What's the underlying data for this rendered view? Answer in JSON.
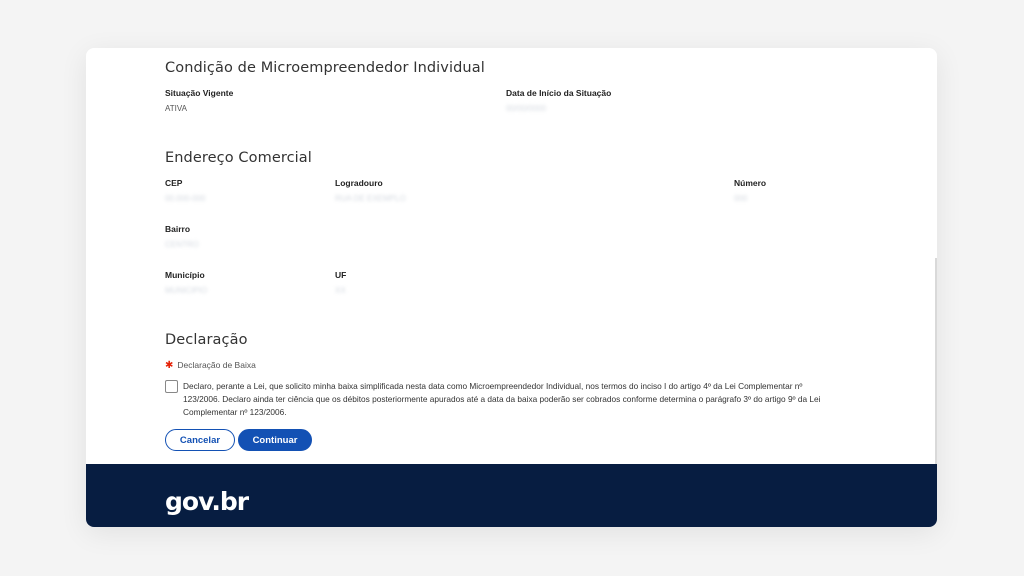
{
  "mei": {
    "title": "Condição de Microempreendedor Individual",
    "situacao_label": "Situação Vigente",
    "situacao_value": "ATIVA",
    "data_inicio_label": "Data de Início da Situação",
    "data_inicio_value": "00/00/0000"
  },
  "endereco": {
    "title": "Endereço Comercial",
    "cep_label": "CEP",
    "cep_value": "00.000-000",
    "logradouro_label": "Logradouro",
    "logradouro_value": "RUA DE EXEMPLO",
    "numero_label": "Número",
    "numero_value": "000",
    "bairro_label": "Bairro",
    "bairro_value": "CENTRO",
    "municipio_label": "Município",
    "municipio_value": "MUNICIPIO",
    "uf_label": "UF",
    "uf_value": "XX"
  },
  "declaracao": {
    "title": "Declaração",
    "required_label": "Declaração de Baixa",
    "text": "Declaro, perante a Lei, que solicito minha baixa simplificada nesta data como Microempreendedor Individual, nos termos do inciso I do artigo 4º da Lei Complementar nº 123/2006. Declaro ainda ter ciência que os débitos posteriormente apurados até a data da baixa poderão ser cobrados conforme determina o parágrafo 3º do artigo 9º da Lei Complementar nº 123/2006.",
    "checked": false
  },
  "actions": {
    "cancel_label": "Cancelar",
    "continue_label": "Continuar"
  },
  "footer": {
    "logo": "gov.br"
  },
  "colors": {
    "primary": "#1351b4",
    "footer_bg": "#071d41",
    "required": "#e52207"
  }
}
